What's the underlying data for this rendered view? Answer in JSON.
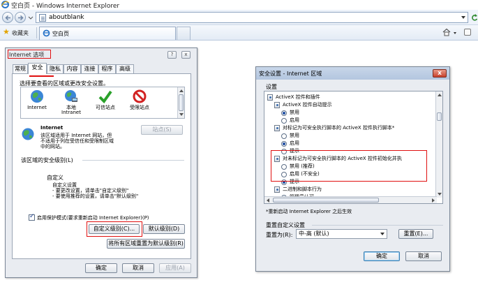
{
  "browser": {
    "window_title": "空白页 - Windows Internet Explorer",
    "address": "aboutblank",
    "favorites_label": "收藏夹",
    "tab_label": "空白页"
  },
  "internet_options": {
    "title": "Internet 选项",
    "help_glyph": "?",
    "close_glyph": "x",
    "tabs": [
      {
        "label": "常规"
      },
      {
        "label": "安全"
      },
      {
        "label": "隐私"
      },
      {
        "label": "内容"
      },
      {
        "label": "连接"
      },
      {
        "label": "程序"
      },
      {
        "label": "高级"
      }
    ],
    "active_tab": "安全",
    "zone_prompt": "选择要查看的区域或更改安全设置。",
    "zones": [
      {
        "label": "Internet",
        "label2": "",
        "icon": "globe-icon"
      },
      {
        "label": "本地",
        "label2": "Intranet",
        "icon": "intranet-globe-icon"
      },
      {
        "label": "可信站点",
        "label2": "",
        "icon": "checkmark-icon"
      },
      {
        "label": "受限站点",
        "label2": "",
        "icon": "no-entry-icon"
      }
    ],
    "selected_zone_name": "Internet",
    "zone_desc_lines": [
      "该区域适用于 Internet 网站，但",
      "不适用于列在受信任和受限制区域",
      "中的网站。"
    ],
    "sites_button": "站点(S)",
    "security_level_label": "该区域的安全级别(L)",
    "custom_title": "自定义",
    "custom_lines": [
      "自定义设置",
      "- 要更改设置，请单击\"自定义级别\"",
      "- 要使用推荐的设置，请单击\"默认级别\""
    ],
    "protected_mode_label": "启用保护模式(要求重新启动 Internet Explorer)(P)",
    "protected_mode_checked": true,
    "custom_level_button": "自定义级别(C)...",
    "default_level_button": "默认级别(D)",
    "reset_all_button": "将所有区域重置为默认级别(R)",
    "ok_button": "确定",
    "cancel_button": "取消",
    "apply_button": "应用(A)"
  },
  "security_settings": {
    "title": "安全设置 - Internet 区域",
    "close_glyph": "x",
    "settings_label": "设置",
    "tree": [
      {
        "kind": "group",
        "indent": 0,
        "text": "ActiveX 控件和插件"
      },
      {
        "kind": "setting",
        "indent": 1,
        "text": "ActiveX 控件自动提示"
      },
      {
        "kind": "option",
        "indent": 2,
        "text": "禁用",
        "selected": true
      },
      {
        "kind": "option",
        "indent": 2,
        "text": "启用",
        "selected": false
      },
      {
        "kind": "setting",
        "indent": 1,
        "text": "对标记为可安全执行脚本的 ActiveX 控件执行脚本*"
      },
      {
        "kind": "option",
        "indent": 2,
        "text": "禁用",
        "selected": false
      },
      {
        "kind": "option",
        "indent": 2,
        "text": "启用",
        "selected": true
      },
      {
        "kind": "option",
        "indent": 2,
        "text": "提示",
        "selected": false
      },
      {
        "kind": "setting",
        "indent": 1,
        "text": "对未标记为可安全执行脚本的 ActiveX 控件初始化并执"
      },
      {
        "kind": "option",
        "indent": 2,
        "text": "禁用 (推荐)",
        "selected": false
      },
      {
        "kind": "option",
        "indent": 2,
        "text": "启用 (不安全)",
        "selected": false
      },
      {
        "kind": "option",
        "indent": 2,
        "text": "提示",
        "selected": true
      },
      {
        "kind": "setting",
        "indent": 1,
        "text": "二进制和脚本行为"
      },
      {
        "kind": "option",
        "indent": 2,
        "text": "管理员认可",
        "selected": false
      }
    ],
    "restart_note": "*重新启动 Internet Explorer 之后生效",
    "reset_group_label": "重置自定义设置",
    "reset_to_label": "重置为(R):",
    "reset_to_value": "中-高 (默认)",
    "reset_button": "重置(E)...",
    "ok_button": "确定",
    "cancel_button": "取消"
  }
}
